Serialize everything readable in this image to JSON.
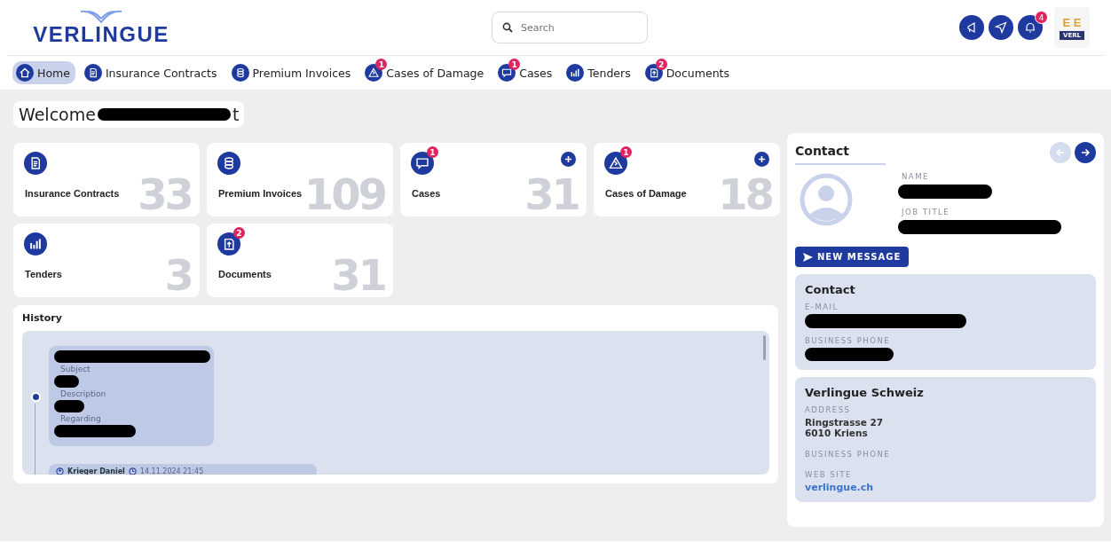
{
  "header": {
    "logo": "VERLINGUE",
    "search": {
      "placeholder": "Search"
    },
    "notification_count": "4",
    "avatar": {
      "letters": "E E",
      "tag": "VERL"
    }
  },
  "nav": [
    {
      "label": "Home",
      "kind": "home",
      "selected": true
    },
    {
      "label": "Insurance Contracts",
      "kind": "doc",
      "selected": false
    },
    {
      "label": "Premium Invoices",
      "kind": "coins",
      "selected": false
    },
    {
      "label": "Cases of Damage",
      "kind": "damage",
      "badge": "1",
      "selected": false
    },
    {
      "label": "Cases",
      "kind": "chat",
      "badge": "1",
      "selected": false
    },
    {
      "label": "Tenders",
      "kind": "bars",
      "selected": false
    },
    {
      "label": "Documents",
      "kind": "upload",
      "badge": "2",
      "selected": false
    }
  ],
  "welcome": {
    "text": "Welcome",
    "tail": "t"
  },
  "tiles": [
    {
      "label": "Insurance Contracts",
      "kind": "doc",
      "count": "33",
      "addable": false
    },
    {
      "label": "Premium Invoices",
      "kind": "coins",
      "count": "109",
      "addable": false
    },
    {
      "label": "Cases",
      "kind": "chat",
      "count": "31",
      "badge": "1",
      "addable": true
    },
    {
      "label": "Cases of Damage",
      "kind": "damage",
      "count": "18",
      "badge": "1",
      "addable": true
    },
    {
      "label": "Tenders",
      "kind": "bars",
      "count": "3",
      "addable": false
    },
    {
      "label": "Documents",
      "kind": "upload",
      "count": "31",
      "badge": "2",
      "addable": false
    }
  ],
  "history": {
    "title": "History",
    "entry": {
      "fields": [
        "Subject",
        "Description",
        "Regarding"
      ]
    },
    "footer": {
      "author": "Krieger Daniel",
      "date": "14.11.2024 21:45"
    }
  },
  "contact": {
    "title": "Contact",
    "name_label": "NAME",
    "job_label": "JOB TITLE",
    "prev_enabled": false,
    "next_enabled": true,
    "button": "NEW MESSAGE",
    "details": {
      "title": "Contact",
      "email_label": "E-MAIL",
      "phone_label": "BUSINESS PHONE"
    },
    "office": {
      "title": "Verlingue Schweiz",
      "address_label": "ADDRESS",
      "address": [
        "Ringstrasse 27",
        "6010 Kriens"
      ],
      "phone_label": "BUSINESS PHONE",
      "web_label": "WEB SITE",
      "web": "verlingue.ch"
    }
  }
}
